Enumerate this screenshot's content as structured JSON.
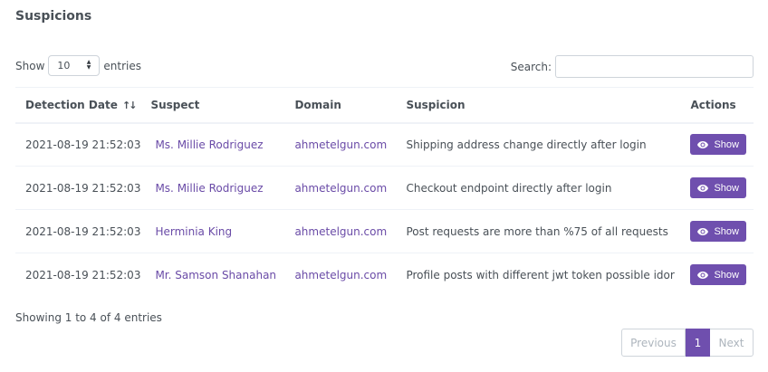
{
  "card": {
    "title": "Suspicions"
  },
  "length": {
    "prefix": "Show",
    "value": "10",
    "suffix": "entries"
  },
  "search": {
    "label": "Search:",
    "value": ""
  },
  "table": {
    "headers": {
      "detection_date": "Detection Date",
      "suspect": "Suspect",
      "domain": "Domain",
      "suspicion": "Suspicion",
      "actions": "Actions"
    },
    "rows": [
      {
        "date": "2021-08-19 21:52:03",
        "suspect": "Ms. Millie Rodriguez",
        "domain": "ahmetelgun.com",
        "suspicion": "Shipping address change directly after login",
        "action": "Show"
      },
      {
        "date": "2021-08-19 21:52:03",
        "suspect": "Ms. Millie Rodriguez",
        "domain": "ahmetelgun.com",
        "suspicion": "Checkout endpoint directly after login",
        "action": "Show"
      },
      {
        "date": "2021-08-19 21:52:03",
        "suspect": "Herminia King",
        "domain": "ahmetelgun.com",
        "suspicion": "Post requests are more than %75 of all requests",
        "action": "Show"
      },
      {
        "date": "2021-08-19 21:52:03",
        "suspect": "Mr. Samson Shanahan",
        "domain": "ahmetelgun.com",
        "suspicion": "Profile posts with different jwt token possible idor",
        "action": "Show"
      }
    ]
  },
  "info": "Showing 1 to 4 of 4 entries",
  "pagination": {
    "previous": "Previous",
    "current": "1",
    "next": "Next"
  },
  "colors": {
    "accent": "#6f4fae",
    "link": "#6a4ba7"
  }
}
